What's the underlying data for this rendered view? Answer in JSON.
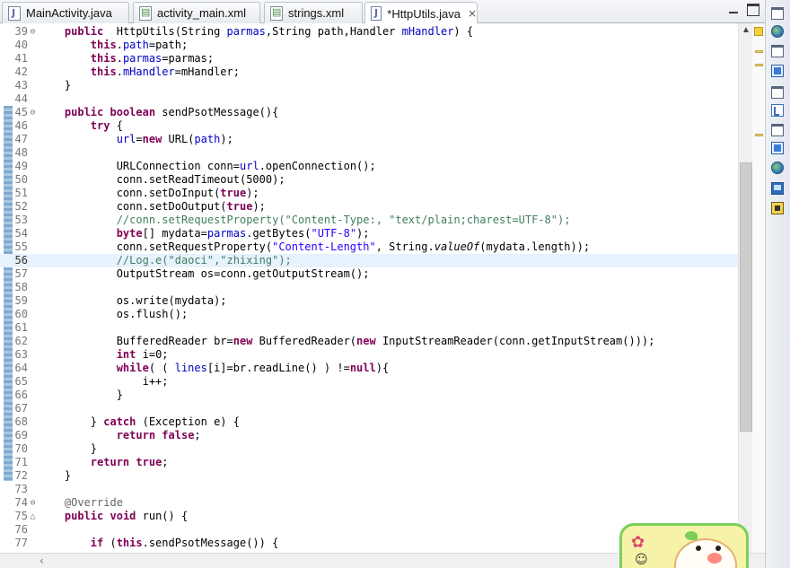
{
  "tabs": [
    {
      "label": "MainActivity.java",
      "type": "java"
    },
    {
      "label": "activity_main.xml",
      "type": "xml"
    },
    {
      "label": "strings.xml",
      "type": "xml"
    },
    {
      "label": "*HttpUtils.java",
      "type": "java",
      "active": true
    }
  ],
  "editor": {
    "current_line": "56",
    "lines": [
      {
        "n": "39",
        "fold": "⊖"
      },
      {
        "n": "40"
      },
      {
        "n": "41"
      },
      {
        "n": "42"
      },
      {
        "n": "43"
      },
      {
        "n": "44"
      },
      {
        "n": "45",
        "fold": "⊖"
      },
      {
        "n": "46"
      },
      {
        "n": "47"
      },
      {
        "n": "48"
      },
      {
        "n": "49"
      },
      {
        "n": "50"
      },
      {
        "n": "51"
      },
      {
        "n": "52"
      },
      {
        "n": "53"
      },
      {
        "n": "54"
      },
      {
        "n": "55"
      },
      {
        "n": "56"
      },
      {
        "n": "57"
      },
      {
        "n": "58"
      },
      {
        "n": "59"
      },
      {
        "n": "60"
      },
      {
        "n": "61"
      },
      {
        "n": "62"
      },
      {
        "n": "63"
      },
      {
        "n": "64"
      },
      {
        "n": "65"
      },
      {
        "n": "66"
      },
      {
        "n": "67"
      },
      {
        "n": "68"
      },
      {
        "n": "69"
      },
      {
        "n": "70"
      },
      {
        "n": "71"
      },
      {
        "n": "72"
      },
      {
        "n": "73"
      },
      {
        "n": "74",
        "fold": "⊖"
      },
      {
        "n": "75",
        "fold": "△"
      },
      {
        "n": "76"
      },
      {
        "n": "77"
      }
    ],
    "tokens": {
      "l39_kw": "public",
      "l39_rest1": "  HttpUtils(String ",
      "l39_f1": "parmas",
      "l39_rest2": ",String path,Handler ",
      "l39_f2": "mHandler",
      "l39_rest3": ") {",
      "this": "this",
      "l40_f": "path",
      "l40_rest": "=path;",
      "l41_f": "parmas",
      "l41_rest": "=parmas;",
      "l42_f": "mHandler",
      "l42_rest": "=mHandler;",
      "brace_close": "}",
      "l45_kw1": "public",
      "l45_kw2": "boolean",
      "l45_rest": " sendPsotMessage(){",
      "l46_kw": "try",
      "l46_rest": " {",
      "l47_f": "url",
      "l47_eq": "=",
      "l47_kw": "new",
      "l47_rest": " URL(",
      "l47_f2": "path",
      "l47_end": ");",
      "l49_a": "URLConnection ",
      "l49_f": "conn",
      "l49_b": "=",
      "l49_f2": "url",
      "l49_c": ".openConnection();",
      "l50": "conn.setReadTimeout(5000);",
      "l51_a": "conn.setDoInput(",
      "true": "true",
      "l51_b": ");",
      "l52_a": "conn.setDoOutput(",
      "l53_cmt": "//conn.setRequestProperty(\"Content-Type:, \"text/plain;charest=UTF-8\");",
      "l54_kw": "byte",
      "l54_a": "[] mydata=",
      "l54_f": "parmas",
      "l54_b": ".getBytes(",
      "l54_str": "\"UTF-8\"",
      "l54_c": ");",
      "l55_a": "conn.setRequestProperty(",
      "l55_str": "\"Content-Length\"",
      "l55_b": ", String.",
      "l55_it": "valueOf",
      "l55_c": "(mydata.length));",
      "l56_cmt": "//Log.e(\"daoci\",\"zhixing\");",
      "l57": "OutputStream os=conn.getOutputStream();",
      "l59": "os.write(mydata);",
      "l60": "os.flush();",
      "l62_a": "BufferedReader br=",
      "new": "new",
      "l62_b": " BufferedReader(",
      "l62_c": " InputStreamReader(conn.getInputStream()));",
      "l63_kw": "int",
      "l63_rest": " i=0;",
      "l64_kw": "while",
      "l64_a": "( ( ",
      "l64_f": "lines",
      "l64_b": "[i]=br.readLine() ) !=",
      "l64_null": "null",
      "l64_c": "){",
      "l65": "i++;",
      "l68_a": "} ",
      "l68_kw": "catch",
      "l68_b": " (Exception e) {",
      "return": "return",
      "false": "false",
      "semi": ";",
      "l74_ann": "@Override",
      "l75_kw1": "public",
      "l75_kw2": "void",
      "l75_rest": " run() {",
      "l77_kw": "if",
      "l77_a": " (",
      "l77_b": ".sendPsotMessage()) {"
    }
  },
  "colors": {
    "keyword": "#7f0055",
    "field": "#0000c0",
    "string": "#2a00ff",
    "comment": "#3f7f5f",
    "annotation": "#646464",
    "current_line": "#e8f2fe"
  },
  "icons": {
    "tab_close": "×",
    "minimize": "minimize-icon",
    "maximize": "maximize-icon",
    "scroll_up": "▲",
    "scroll_left": "‹"
  }
}
